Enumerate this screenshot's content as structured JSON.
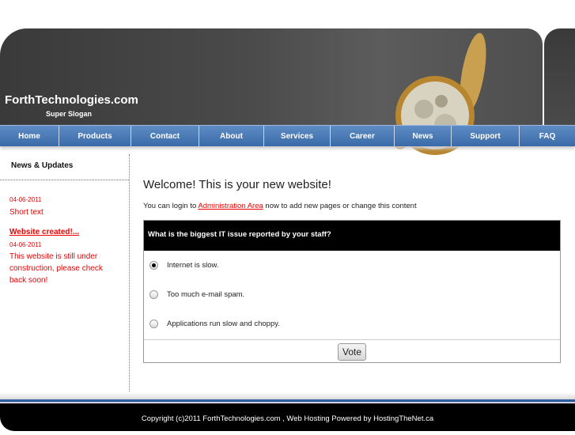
{
  "header": {
    "title": "ForthTechnologies.com",
    "slogan": "Super Slogan"
  },
  "nav": [
    "Home",
    "Products",
    "Contact",
    "About",
    "Services",
    "Career",
    "News",
    "Support",
    "FAQ"
  ],
  "sidebar": {
    "title": "News & Updates",
    "items": [
      {
        "date": "04-06-2011",
        "text": "Short text"
      },
      {
        "title": "Website created!...",
        "date": "04-06-2011",
        "text": "This website is still under construction, please check back soon!"
      }
    ]
  },
  "main": {
    "welcome": "Welcome! This is your new website!",
    "intro_before": "You can login to ",
    "intro_link": "Administration Area",
    "intro_after": " now to add new pages or change this content"
  },
  "poll": {
    "question": "What is the biggest IT issue reported by your staff?",
    "options": [
      "Internet is slow.",
      "Too much e-mail spam.",
      "Applications run slow and choppy."
    ],
    "selected_index": 0,
    "vote_label": "Vote"
  },
  "footer": {
    "text": "Copyright (c)2011 ForthTechnologies.com , Web Hosting Powered by HostingTheNet.ca"
  }
}
